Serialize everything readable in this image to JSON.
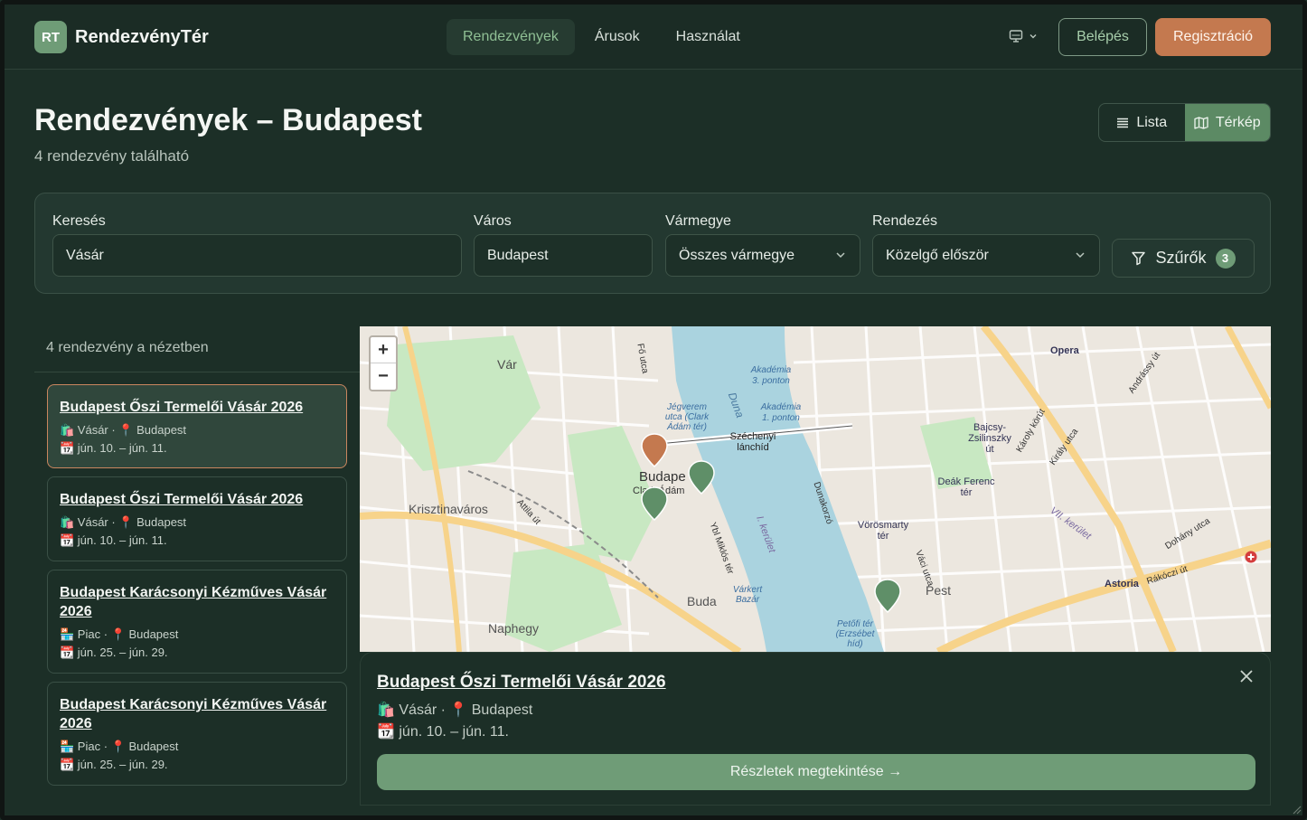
{
  "header": {
    "logo_badge": "RT",
    "logo_text": "RendezvényTér",
    "nav": [
      "Rendezvények",
      "Árusok",
      "Használat"
    ],
    "login": "Belépés",
    "register": "Regisztráció",
    "theme_icon": "monitor-icon"
  },
  "page": {
    "title": "Rendezvények – Budapest",
    "subtitle": "4 rendezvény található",
    "view_list": "Lista",
    "view_map": "Térkép"
  },
  "filters": {
    "search_label": "Keresés",
    "search_value": "Vásár",
    "city_label": "Város",
    "city_value": "Budapest",
    "county_label": "Vármegye",
    "county_value": "Összes vármegye",
    "sort_label": "Rendezés",
    "sort_value": "Közelgő először",
    "filters_button": "Szűrők",
    "filters_count": "3"
  },
  "list": {
    "header": "4 rendezvény a nézetben",
    "cards": [
      {
        "title": "Budapest Őszi Termelői Vásár 2026",
        "meta": "🛍️ Vásár · 📍 Budapest",
        "date": "📆 jún. 10. – jún. 11."
      },
      {
        "title": "Budapest Őszi Termelői Vásár 2026",
        "meta": "🛍️ Vásár · 📍 Budapest",
        "date": "📆 jún. 10. – jún. 11."
      },
      {
        "title": "Budapest Karácsonyi Kézműves Vásár 2026",
        "meta": "🏪 Piac · 📍 Budapest",
        "date": "📆 jún. 25. – jún. 29."
      },
      {
        "title": "Budapest Karácsonyi Kézműves Vásár 2026",
        "meta": "🏪 Piac · 📍 Budapest",
        "date": "📆 jún. 25. – jún. 29."
      }
    ]
  },
  "map": {
    "zoom_in": "+",
    "zoom_out": "−",
    "labels": {
      "var": "Vár",
      "budapest": "Budape",
      "clark": "Clark Ádám",
      "krisztinavaros": "Krisztinaváros",
      "duna": "Duna",
      "szechenyi": "Széchenyi lánchíd",
      "buda": "Buda",
      "naphegy": "Naphegy",
      "pest": "Pest",
      "vorosmarty": "Vörösmarty tér",
      "deak": "Deák Ferenc tér",
      "bajcsy": "Bajcsy-Zsilinszky út",
      "opera": "Opera",
      "astoria": "Astoria",
      "akademia3": "Akadémia 3. ponton",
      "akademia1": "Akadémia 1. ponton",
      "jegverem": "Jégverem utca (Clark Ádám tér)",
      "varkert": "Várkert Bazár",
      "petofi": "Petőfi tér (Erzsébet híd)",
      "fo_utca": "Fő utca",
      "ybl": "Ybl Miklós tér",
      "dunakorzo": "Dunakorzó",
      "vaci": "Váci utca",
      "fovam": "Károly körút",
      "vii": "VII. kerület",
      "kerulet_i": "I. kerület",
      "attila": "Attila út",
      "kiraly": "Király utca",
      "dohany": "Dohány utca",
      "rakoczi": "Rákóczi út",
      "andrassy": "Andrássy út"
    },
    "colors": {
      "water": "#aad3df",
      "park": "#c8e8c2",
      "road": "#ffffff",
      "major": "#f7d38a",
      "pin_green": "#5f8f68",
      "pin_orange": "#c4794f"
    }
  },
  "popup": {
    "title": "Budapest Őszi Termelői Vásár 2026",
    "meta": "🛍️ Vásár · 📍 Budapest",
    "date": "📆 jún. 10. – jún. 11.",
    "button": "Részletek megtekintése →",
    "close_icon": "close-icon"
  }
}
